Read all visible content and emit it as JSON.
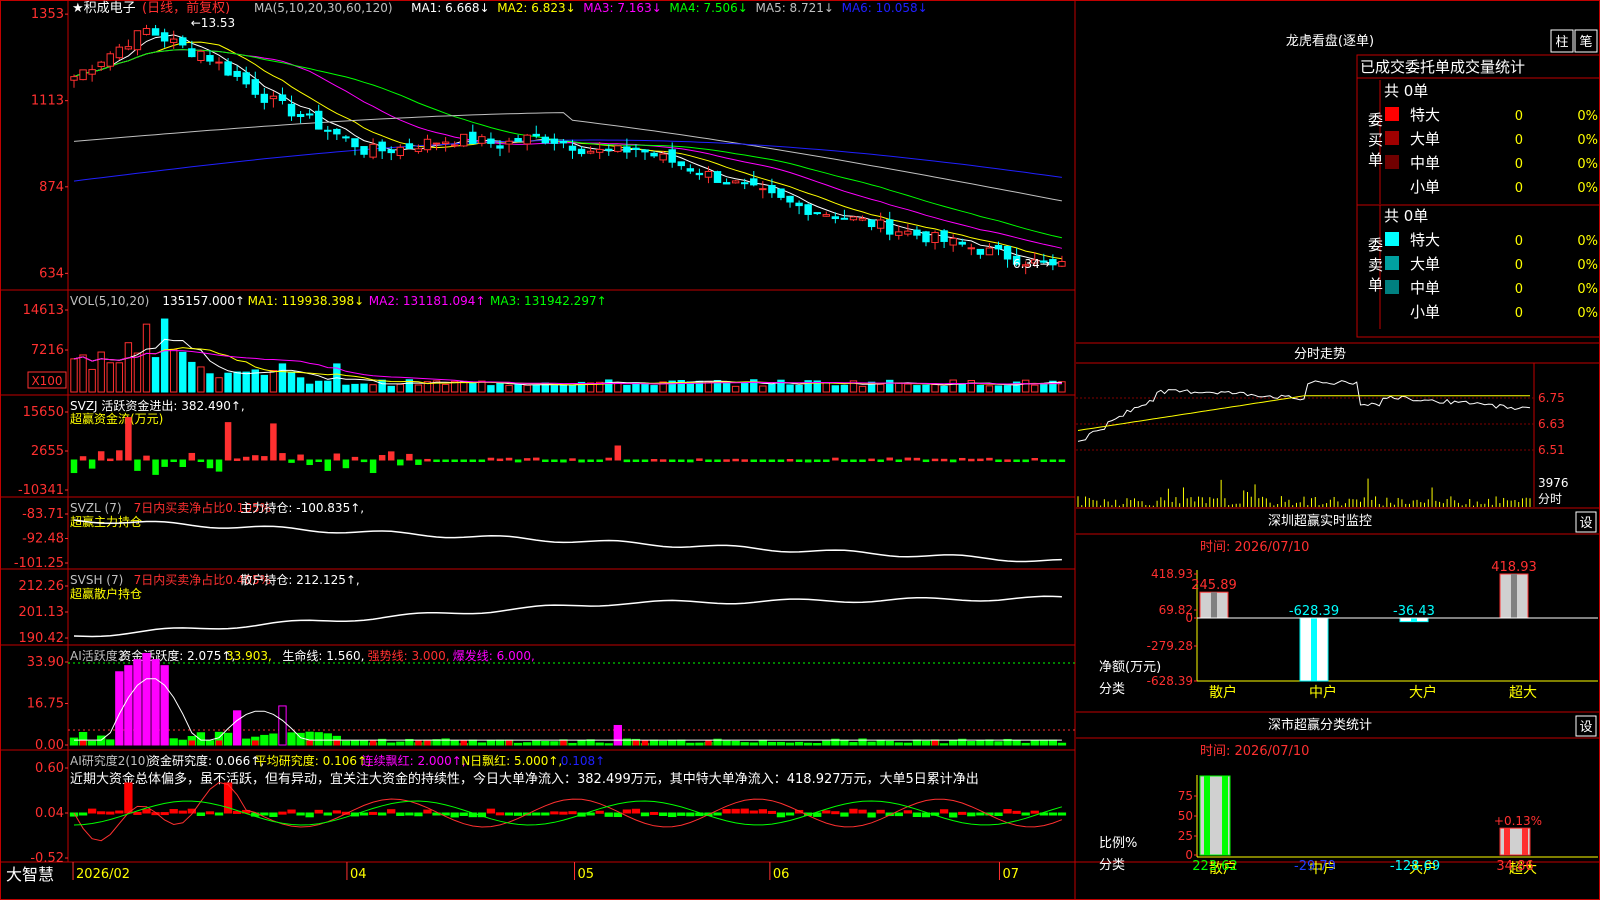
{
  "stock": {
    "name": "积成电子",
    "mode": "(日线，前复权)",
    "star": "★"
  },
  "brand": "大智慧",
  "colors": {
    "up": "#ff3030",
    "down": "#00ffff",
    "grid": "#c00000",
    "ma1": "#ffffff",
    "ma2": "#ffff00",
    "ma3": "#ff00ff",
    "ma4": "#00ff00",
    "ma5": "#c0c0c0",
    "ma6": "#2020ff"
  },
  "price_panel": {
    "legend": [
      {
        "text": "MA(5,10,20,30,60,120)",
        "color": "#c0c0c0"
      },
      {
        "text": "MA1: 6.668↓",
        "color": "#ffffff"
      },
      {
        "text": "MA2: 6.823↓",
        "color": "#ffff00"
      },
      {
        "text": "MA3: 7.163↓",
        "color": "#ff00ff"
      },
      {
        "text": "MA4: 7.506↓",
        "color": "#00ff00"
      },
      {
        "text": "MA5: 8.721↓",
        "color": "#c0c0c0"
      },
      {
        "text": "MA6: 10.058↓",
        "color": "#2020ff"
      }
    ],
    "y_ticks": [
      "1353",
      "1113",
      "874",
      "634"
    ],
    "high_label": "13.53",
    "low_label": "6.34",
    "low_arrow": "→",
    "high_arrow": "←"
  },
  "vol_panel": {
    "legend": [
      {
        "text": "VOL(5,10,20)",
        "color": "#c0c0c0"
      },
      {
        "text": "135157.000↑",
        "color": "#ffffff"
      },
      {
        "text": "MA1: 119938.398↓",
        "color": "#ffff00"
      },
      {
        "text": "MA2: 131181.094↑",
        "color": "#ff00ff"
      },
      {
        "text": "MA3: 131942.297↑",
        "color": "#00ff00"
      }
    ],
    "y_ticks": [
      "14613",
      "7216"
    ],
    "unit": "X100"
  },
  "svzj_panel": {
    "legend": [
      {
        "text": "SVZJ  活跃资金进出: 382.490↑,",
        "color": "#ffffff"
      }
    ],
    "sub": "超赢资金流(万元)",
    "y_ticks": [
      "15650",
      "2655",
      "-10341"
    ]
  },
  "svzl_panel": {
    "legend": [
      {
        "text": "SVZL (7)",
        "color": "#c0c0c0"
      },
      {
        "text": "7日内买卖净占比0.105%",
        "color": "#ff3030"
      },
      {
        "text": "主力持仓: -100.835↑,",
        "color": "#ffffff"
      }
    ],
    "sub": "超赢主力持仓",
    "y_ticks": [
      "-83.71",
      "-92.48",
      "-101.25"
    ]
  },
  "svsh_panel": {
    "legend": [
      {
        "text": "SVSH (7)",
        "color": "#c0c0c0"
      },
      {
        "text": "7日内买卖净占比0.405%",
        "color": "#ff3030"
      },
      {
        "text": "散户持仓: 212.125↑,",
        "color": "#ffffff"
      }
    ],
    "sub": "超赢散户持仓",
    "y_ticks": [
      "212.26",
      "201.13",
      "190.42"
    ]
  },
  "ai1_panel": {
    "legend": [
      {
        "text": "AI活跃度2",
        "color": "#c0c0c0"
      },
      {
        "text": "资金活跃度: 2.075↑,",
        "color": "#ffffff"
      },
      {
        "text": "33.903,",
        "color": "#ffff00"
      },
      {
        "text": "生命线: 1.560,",
        "color": "#ffffff"
      },
      {
        "text": "强势线: 3.000,",
        "color": "#ff3030"
      },
      {
        "text": "爆发线: 6.000,",
        "color": "#ff00ff"
      }
    ],
    "y_ticks": [
      "33.90",
      "16.75",
      "0.00"
    ]
  },
  "ai2_panel": {
    "legend": [
      {
        "text": "AI研究度2(10)",
        "color": "#c0c0c0"
      },
      {
        "text": "资金研究度: 0.066↑,",
        "color": "#ffffff"
      },
      {
        "text": "平均研究度: 0.106↑,",
        "color": "#ffff00"
      },
      {
        "text": "连续飘红: 2.000↑,",
        "color": "#ff00ff"
      },
      {
        "text": "N日飘红: 5.000↑,",
        "color": "#ffff00"
      },
      {
        "text": "0.108↑",
        "color": "#2020ff"
      }
    ],
    "comment": "近期大资金总体偏多，虽不活跃，但有异动，宜关注大资金的持续性，今日大单净流入：382.499万元，其中特大单净流入：418.927万元，大单5日累计净出",
    "y_ticks": [
      "0.60",
      "0.04",
      "-0.52"
    ]
  },
  "x_axis": [
    {
      "label": "2026/02",
      "frac": 0.005
    },
    {
      "label": "04",
      "frac": 0.277
    },
    {
      "label": "05",
      "frac": 0.503
    },
    {
      "label": "06",
      "frac": 0.697
    },
    {
      "label": "07",
      "frac": 0.925
    }
  ],
  "lhb": {
    "title": "龙虎看盘(逐单)",
    "tabs": [
      "柱",
      "笔"
    ],
    "subtitle": "已成交委托单成交量统计",
    "buy": {
      "label": "委买单",
      "total": "共 0单",
      "rows": [
        {
          "name": "特大",
          "color": "#ff0000",
          "count": "0",
          "pct": "0%"
        },
        {
          "name": "大单",
          "color": "#a00000",
          "count": "0",
          "pct": "0%"
        },
        {
          "name": "中单",
          "color": "#700000",
          "count": "0",
          "pct": "0%"
        },
        {
          "name": "小单",
          "color": "#000000",
          "count": "0",
          "pct": "0%"
        }
      ]
    },
    "sell": {
      "label": "委卖单",
      "total": "共 0单",
      "rows": [
        {
          "name": "特大",
          "color": "#00ffff",
          "count": "0",
          "pct": "0%"
        },
        {
          "name": "大单",
          "color": "#00a0a0",
          "count": "0",
          "pct": "0%"
        },
        {
          "name": "中单",
          "color": "#008080",
          "count": "0",
          "pct": "0%"
        },
        {
          "name": "小单",
          "color": "#000000",
          "count": "0",
          "pct": "0%"
        }
      ]
    }
  },
  "intraday": {
    "title": "分时走势",
    "y_ticks": [
      "6.75",
      "6.63",
      "6.51"
    ],
    "vol_tick": "3976",
    "unit": "分时"
  },
  "monitor": {
    "title": "深圳超赢实时监控",
    "settings": "设",
    "time": "时间: 2026/07/10",
    "y_ticks": [
      "418.93",
      "69.82",
      "0",
      "-279.28",
      "-628.39"
    ],
    "y_label": "净额(万元)",
    "x_label": "分类",
    "categories": [
      "散户",
      "中户",
      "大户",
      "超大"
    ],
    "values": [
      245.89,
      -628.39,
      -36.43,
      418.93
    ],
    "value_labels": [
      "245.89",
      "-628.39",
      "-36.43",
      "418.93"
    ]
  },
  "classify": {
    "title": "深市超赢分类统计",
    "settings": "设",
    "time": "时间: 2026/07/10",
    "y_ticks": [
      "75",
      "50",
      "25",
      "0"
    ],
    "y_label": "比例%",
    "x_label": "分类",
    "categories": [
      "散户",
      "中户",
      "大户",
      "超大"
    ],
    "values": [
      223.62,
      -29.79,
      -128.69,
      34.86
    ],
    "value_labels": [
      "223.62",
      "-29.79",
      "-128.69",
      "34.86"
    ],
    "top_label": "+0.13%"
  },
  "chart_data": {
    "type": "candlestick",
    "price_axis_labels": [
      "1353",
      "1113",
      "874",
      "634"
    ],
    "high": 13.53,
    "low": 6.34,
    "series": [
      {
        "name": "MA1",
        "value": 6.668
      },
      {
        "name": "MA2",
        "value": 6.823
      },
      {
        "name": "MA3",
        "value": 7.163
      },
      {
        "name": "MA4",
        "value": 7.506
      },
      {
        "name": "MA5",
        "value": 8.721
      },
      {
        "name": "MA6",
        "value": 10.058
      }
    ],
    "volume": {
      "value": 135157.0,
      "ma1": 119938.398,
      "ma2": 131181.094,
      "ma3": 131942.297
    },
    "x_labels": [
      "2026/02",
      "04",
      "05",
      "06",
      "07"
    ]
  }
}
